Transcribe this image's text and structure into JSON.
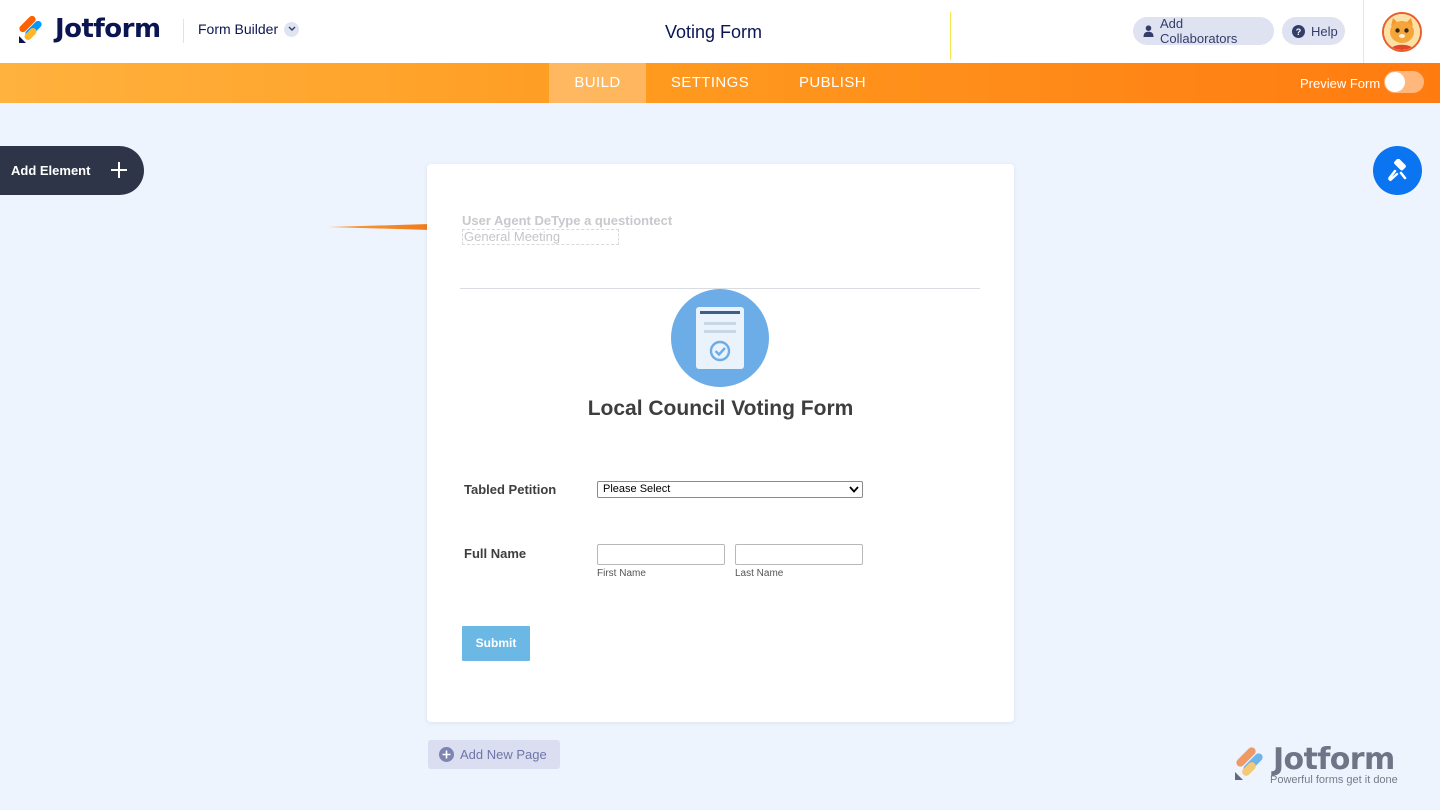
{
  "header": {
    "logo_text": "Jotform",
    "builder_label": "Form Builder",
    "form_title": "Voting Form",
    "collaborators_label": "Add Collaborators",
    "help_label": "Help"
  },
  "nav": {
    "tabs": [
      {
        "label": "BUILD",
        "active": true
      },
      {
        "label": "SETTINGS",
        "active": false
      },
      {
        "label": "PUBLISH",
        "active": false
      }
    ],
    "preview_label": "Preview Form",
    "preview_on": false
  },
  "sidebar": {
    "add_element_label": "Add Element"
  },
  "form": {
    "question_label": "User Agent DeType a questiontect",
    "question_sub": "General  Meeting",
    "heading": "Local Council Voting Form",
    "fields": {
      "petition_label": "Tabled Petition",
      "petition_value": "Please Select",
      "fullname_label": "Full Name",
      "first_name_sublabel": "First Name",
      "last_name_sublabel": "Last Name",
      "first_name_value": "",
      "last_name_value": ""
    },
    "submit_label": "Submit"
  },
  "footer": {
    "add_page_label": "Add New Page",
    "watermark_text": "Jotform",
    "watermark_tagline": "Powerful forms get it done"
  },
  "colors": {
    "brand_navy": "#0a1551",
    "nav_orange_start": "#ffb23e",
    "nav_orange_end": "#ff7b11",
    "accent_blue": "#0b74f0",
    "submit_blue": "#6cb8e5",
    "annotation_arrow": "#f07a16"
  }
}
